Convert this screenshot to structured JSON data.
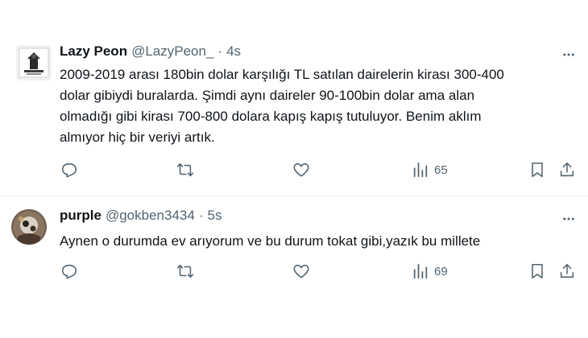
{
  "tweets": [
    {
      "name": "Lazy Peon",
      "handle": "@LazyPeon_",
      "separator": "·",
      "time": "4s",
      "text": "2009-2019 arası 180bin dolar karşılığı TL satılan dairelerin kirası 300-400\ndolar gibiydi buralarda. Şimdi aynı daireler 90-100bin dolar ama alan\nolmadığı gibi kirası 700-800 dolara kapış kapış tutuluyor. Benim aklım\nalmıyor hiç bir veriyi artık.",
      "views": "65"
    },
    {
      "name": "purple",
      "handle": "@gokben3434",
      "separator": "·",
      "time": "5s",
      "text": "Aynen o durumda ev arıyorum ve bu durum tokat gibi,yazık bu millete",
      "views": "69"
    }
  ],
  "colors": {
    "text": "#0f1419",
    "secondary": "#536471",
    "divider": "#eff3f4"
  },
  "icons": [
    "reply-icon",
    "retweet-icon",
    "like-icon",
    "views-icon",
    "bookmark-icon",
    "share-icon",
    "more-icon"
  ]
}
